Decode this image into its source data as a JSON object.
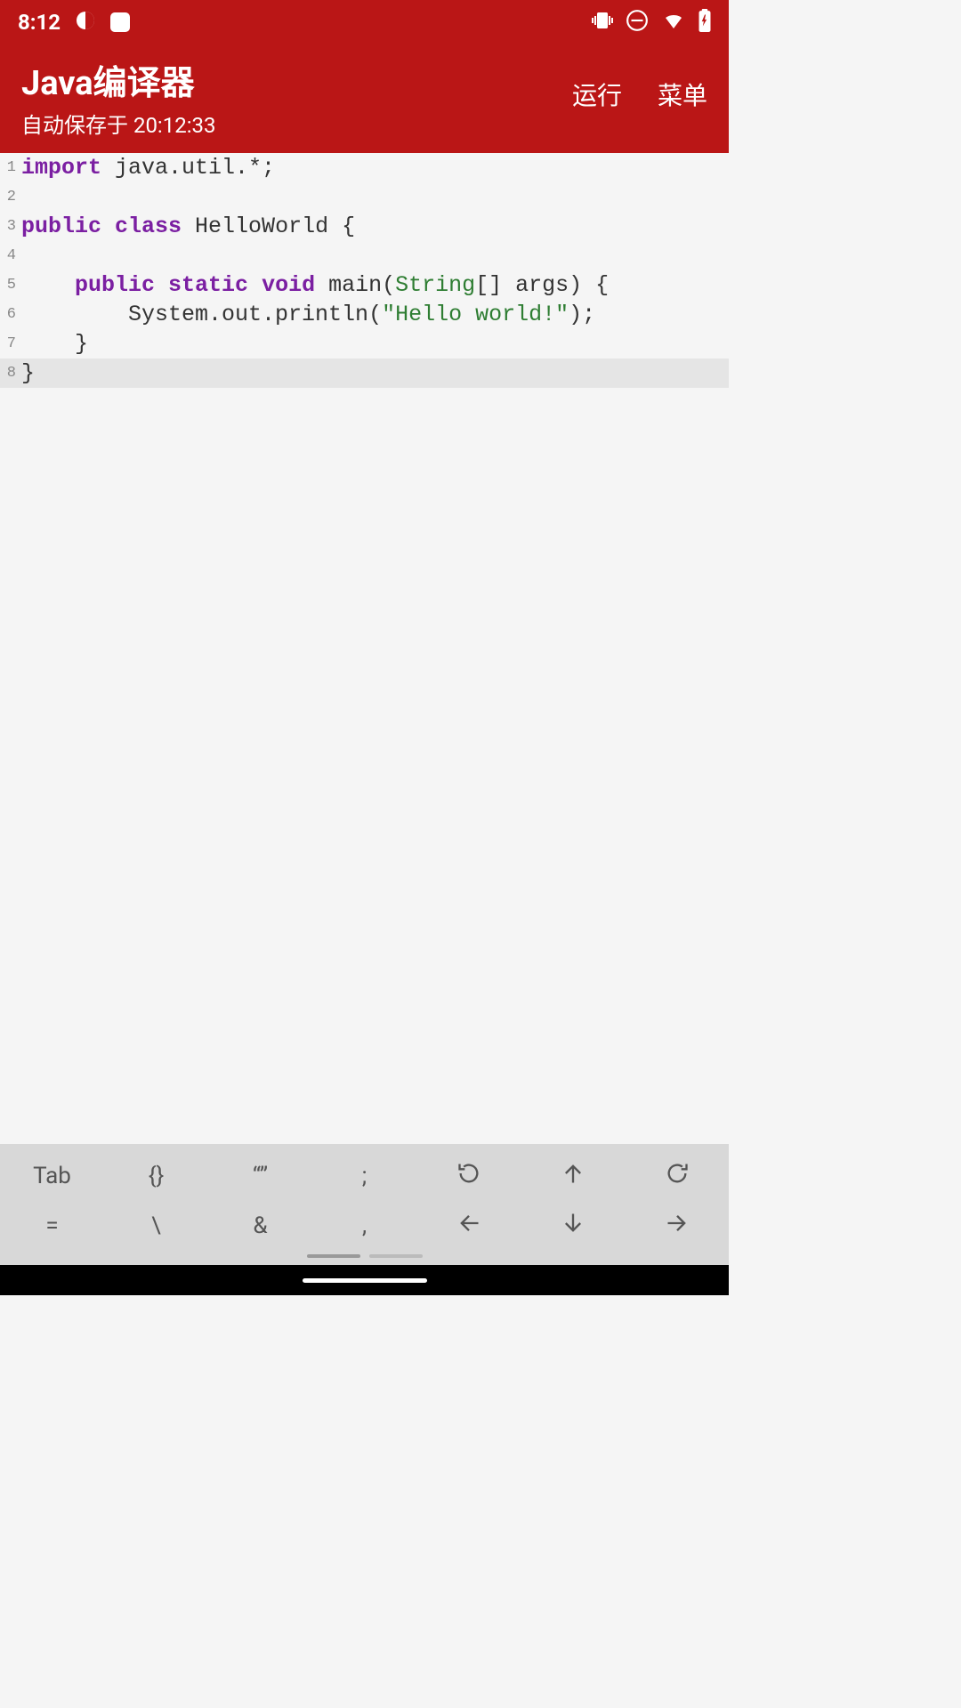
{
  "status_bar": {
    "time": "8:12"
  },
  "header": {
    "title": "Java编译器",
    "save_status": "自动保存于 20:12:33",
    "run_label": "运行",
    "menu_label": "菜单"
  },
  "code": {
    "lines": [
      {
        "num": "1",
        "tokens": [
          {
            "t": "kw",
            "v": "import"
          },
          {
            "t": "txt",
            "v": " java.util.*;"
          }
        ]
      },
      {
        "num": "2",
        "tokens": []
      },
      {
        "num": "3",
        "tokens": [
          {
            "t": "kw",
            "v": "public"
          },
          {
            "t": "txt",
            "v": " "
          },
          {
            "t": "kw",
            "v": "class"
          },
          {
            "t": "txt",
            "v": " HelloWorld {"
          }
        ]
      },
      {
        "num": "4",
        "tokens": []
      },
      {
        "num": "5",
        "tokens": [
          {
            "t": "txt",
            "v": "    "
          },
          {
            "t": "kw",
            "v": "public"
          },
          {
            "t": "txt",
            "v": " "
          },
          {
            "t": "kw",
            "v": "static"
          },
          {
            "t": "txt",
            "v": " "
          },
          {
            "t": "kw",
            "v": "void"
          },
          {
            "t": "txt",
            "v": " main("
          },
          {
            "t": "typ",
            "v": "String"
          },
          {
            "t": "txt",
            "v": "[] args) {"
          }
        ]
      },
      {
        "num": "6",
        "tokens": [
          {
            "t": "txt",
            "v": "        System.out.println("
          },
          {
            "t": "str",
            "v": "\"Hello world!\""
          },
          {
            "t": "txt",
            "v": ");"
          }
        ]
      },
      {
        "num": "7",
        "tokens": [
          {
            "t": "txt",
            "v": "    }"
          }
        ]
      },
      {
        "num": "8",
        "tokens": [
          {
            "t": "txt",
            "v": "}"
          }
        ],
        "highlighted": true
      }
    ]
  },
  "toolbar": {
    "row1": [
      {
        "kind": "text",
        "value": "Tab",
        "name": "tab-key"
      },
      {
        "kind": "text",
        "value": "{}",
        "name": "braces-key"
      },
      {
        "kind": "text",
        "value": "“”",
        "name": "quotes-key"
      },
      {
        "kind": "text",
        "value": ";",
        "name": "semicolon-key"
      },
      {
        "kind": "icon",
        "value": "undo",
        "name": "undo-button"
      },
      {
        "kind": "icon",
        "value": "up",
        "name": "arrow-up-button"
      },
      {
        "kind": "icon",
        "value": "redo",
        "name": "redo-button"
      }
    ],
    "row2": [
      {
        "kind": "text",
        "value": "=",
        "name": "equals-key"
      },
      {
        "kind": "text",
        "value": "\\",
        "name": "backslash-key"
      },
      {
        "kind": "text",
        "value": "&",
        "name": "ampersand-key"
      },
      {
        "kind": "text",
        "value": ",",
        "name": "comma-key"
      },
      {
        "kind": "icon",
        "value": "left",
        "name": "arrow-left-button"
      },
      {
        "kind": "icon",
        "value": "down",
        "name": "arrow-down-button"
      },
      {
        "kind": "icon",
        "value": "right",
        "name": "arrow-right-button"
      }
    ]
  }
}
